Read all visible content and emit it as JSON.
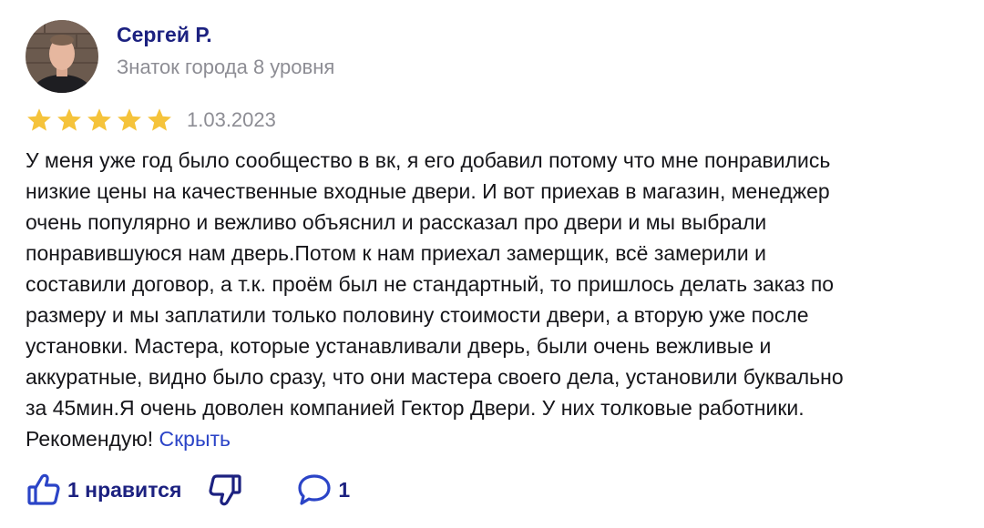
{
  "author": {
    "name": "Сергей Р.",
    "level": "Знаток города 8 уровня"
  },
  "review": {
    "rating": 5,
    "date": "1.03.2023",
    "lines": [
      "У меня уже год было сообщество в вк, я его добавил потому что мне понравились",
      "низкие цены на качественные входные двери. И вот приехав в магазин, менеджер",
      "очень популярно и вежливо объяснил и рассказал про двери и мы выбрали",
      "понравившуюся нам дверь.Потом к нам приехал замерщик, всё замерили и",
      "составили договор, а т.к. проём был не стандартный, то пришлось делать заказ по",
      "размеру и мы заплатили только половину стоимости двери, а вторую уже после",
      "установки. Мастера, которые устанавливали дверь, были очень вежливые и",
      "аккуратные, видно было сразу, что они мастера своего дела, установили буквально",
      "за 45мин.Я очень доволен компанией Гектор Двери. У них толковые работники.",
      "Рекомендую!"
    ],
    "hide_link": "Скрыть"
  },
  "actions": {
    "like_label": "1 нравится",
    "comment_count": "1",
    "like_icon": "thumbs-up-icon",
    "dislike_icon": "thumbs-down-icon",
    "comment_icon": "comment-icon"
  },
  "colors": {
    "name": "#1c2180",
    "link": "#2b44c7",
    "muted": "#8d8d94",
    "star": "#f5c33b",
    "text": "#16161a"
  }
}
